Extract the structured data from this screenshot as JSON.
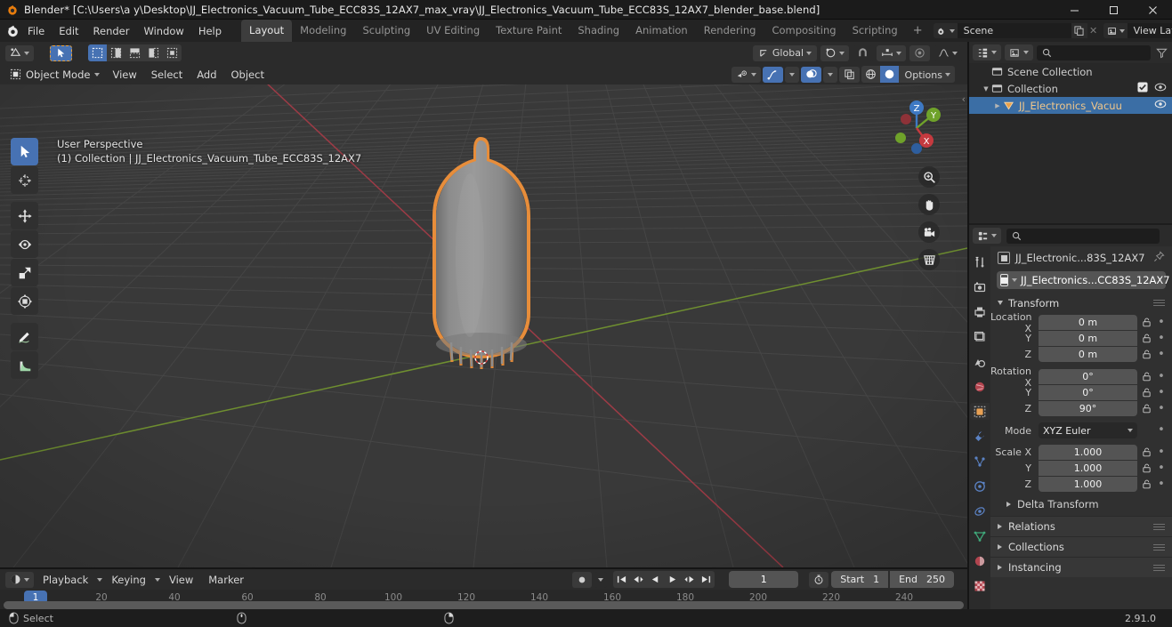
{
  "window": {
    "title": "Blender* [C:\\Users\\a y\\Desktop\\JJ_Electronics_Vacuum_Tube_ECC83S_12AX7_max_vray\\JJ_Electronics_Vacuum_Tube_ECC83S_12AX7_blender_base.blend]",
    "minimize": "—",
    "maximize": "❐",
    "close": "✕"
  },
  "topbar": {
    "menus": [
      "File",
      "Edit",
      "Render",
      "Window",
      "Help"
    ],
    "workspaces": [
      {
        "label": "Layout",
        "active": true
      },
      {
        "label": "Modeling",
        "active": false
      },
      {
        "label": "Sculpting",
        "active": false
      },
      {
        "label": "UV Editing",
        "active": false
      },
      {
        "label": "Texture Paint",
        "active": false
      },
      {
        "label": "Shading",
        "active": false
      },
      {
        "label": "Animation",
        "active": false
      },
      {
        "label": "Rendering",
        "active": false
      },
      {
        "label": "Compositing",
        "active": false
      },
      {
        "label": "Scripting",
        "active": false
      }
    ],
    "add_workspace": "+",
    "scene_name": "Scene",
    "view_layer_name": "View Layer"
  },
  "viewport": {
    "mode": "Object Mode",
    "menus": [
      "View",
      "Select",
      "Add",
      "Object"
    ],
    "transform_orientation": "Global",
    "options_label": "Options",
    "overlay_line1": "User Perspective",
    "overlay_line2": "(1) Collection | JJ_Electronics_Vacuum_Tube_ECC83S_12AX7",
    "gizmo_axes": [
      "X",
      "Y",
      "Z"
    ],
    "colors": {
      "background": "#393939",
      "grid": "#4a4a4a",
      "x_axis": "#a33b46",
      "y_axis": "#6c8c2e",
      "selection_outline": "#f09433",
      "object_surface": "#878787",
      "accent_blue": "#4772b3"
    },
    "nav_buttons": [
      "zoom-icon",
      "hand-icon",
      "camera-icon",
      "grid-icon"
    ]
  },
  "outliner": {
    "search_placeholder": "",
    "rows": [
      {
        "label": "Scene Collection",
        "icon": "collection-icon",
        "depth": 0,
        "selected": false,
        "expand": "",
        "checkbox": false,
        "eye": false
      },
      {
        "label": "Collection",
        "icon": "collection-icon",
        "depth": 1,
        "selected": false,
        "expand": "down",
        "checkbox": true,
        "eye": true
      },
      {
        "label": "JJ_Electronics_Vacuu",
        "icon": "mesh-object-icon",
        "depth": 2,
        "selected": true,
        "expand": "right",
        "checkbox": false,
        "eye": true
      }
    ]
  },
  "properties": {
    "breadcrumb_object": "JJ_Electronic...83S_12AX7",
    "datablock_name": "JJ_Electronics...CC83S_12AX7",
    "tabs": [
      "tool-icon",
      "render-icon",
      "output-icon",
      "view-layer-icon",
      "scene-icon",
      "world-icon",
      "object-icon",
      "modifier-icon",
      "particles-icon",
      "physics-icon",
      "constraint-icon",
      "data-icon",
      "material-icon",
      "texture-icon"
    ],
    "active_tab_index": 6,
    "transform": {
      "title": "Transform",
      "location": {
        "label": "Location X",
        "labels": [
          "Location X",
          "Y",
          "Z"
        ],
        "values": [
          "0 m",
          "0 m",
          "0 m"
        ]
      },
      "rotation": {
        "labels": [
          "Rotation X",
          "Y",
          "Z"
        ],
        "values": [
          "0°",
          "0°",
          "90°"
        ]
      },
      "mode_label": "Mode",
      "mode_value": "XYZ Euler",
      "scale": {
        "labels": [
          "Scale X",
          "Y",
          "Z"
        ],
        "values": [
          "1.000",
          "1.000",
          "1.000"
        ]
      },
      "delta_transform": "Delta Transform"
    },
    "closed_panels": [
      "Relations",
      "Collections",
      "Instancing"
    ]
  },
  "timeline": {
    "menus": [
      "Playback",
      "Keying",
      "View",
      "Marker"
    ],
    "current_frame": "1",
    "start_label": "Start",
    "start_value": "1",
    "end_label": "End",
    "end_value": "250",
    "ruler_ticks": [
      "20",
      "40",
      "60",
      "80",
      "100",
      "120",
      "140",
      "160",
      "180",
      "200",
      "220",
      "240"
    ],
    "playhead_label": "1"
  },
  "statusbar": {
    "mouse_hint": "Select",
    "version": "2.91.0"
  }
}
